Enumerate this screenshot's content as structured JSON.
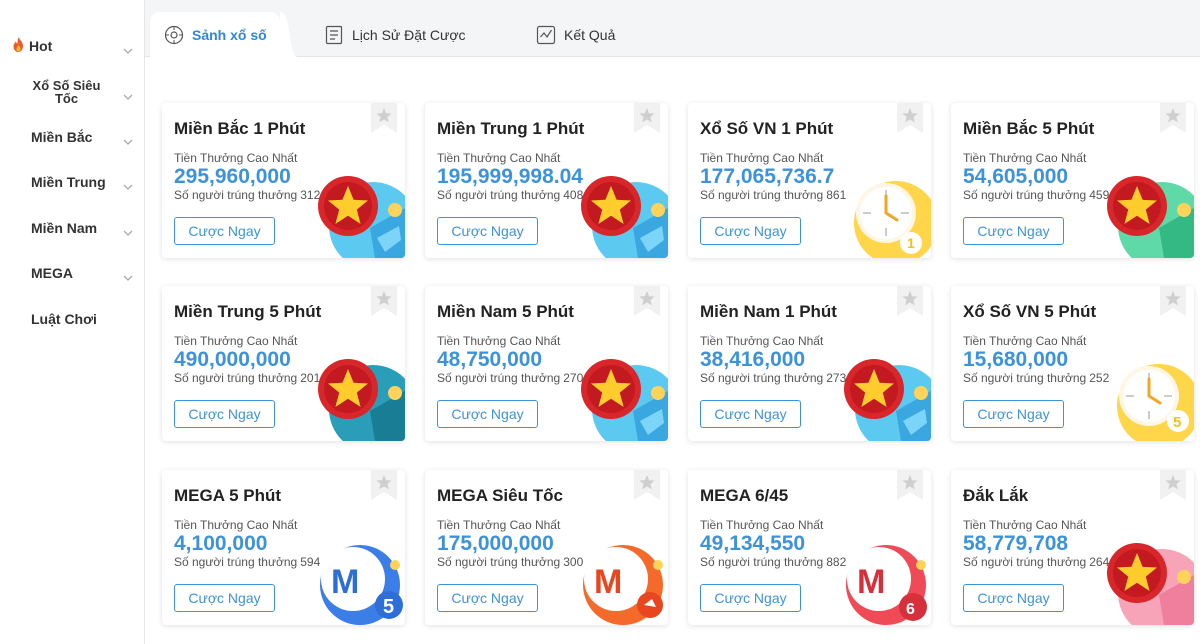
{
  "sidebar": {
    "items": [
      {
        "label": "Hot",
        "hot": true
      },
      {
        "label": "Xổ Số Siêu Tốc"
      },
      {
        "label": "Miền Bắc"
      },
      {
        "label": "Miền Trung"
      },
      {
        "label": "Miền Nam"
      },
      {
        "label": "MEGA"
      },
      {
        "label": "Luật Chơi"
      }
    ]
  },
  "tabs": [
    {
      "label": "Sảnh xổ số",
      "icon": "lottery-hall-icon",
      "active": true
    },
    {
      "label": "Lịch Sử Đặt Cược",
      "icon": "history-icon",
      "active": false
    },
    {
      "label": "Kết Quả",
      "icon": "results-icon",
      "active": false
    }
  ],
  "colors": {
    "accent": "#3d93d9",
    "active_tab": "#2f87d5"
  },
  "cards": [
    {
      "title": "Miền Bắc 1 Phút",
      "prize_label": "Tiền Thưởng Cao Nhất",
      "amount": "295,960,000",
      "winners_label": "Số người trúng thưởng",
      "winners": "312",
      "button": "Cược Ngay",
      "art": "star-blue-icon"
    },
    {
      "title": "Miền Trung 1 Phút",
      "prize_label": "Tiền Thưởng Cao Nhất",
      "amount": "195,999,998.04",
      "winners_label": "Số người trúng thưởng",
      "winners": "408",
      "button": "Cược Ngay",
      "art": "star-blue-icon"
    },
    {
      "title": "Xổ Số VN 1 Phút",
      "prize_label": "Tiền Thưởng Cao Nhất",
      "amount": "177,065,736.7",
      "winners_label": "Số người trúng thưởng",
      "winners": "861",
      "button": "Cược Ngay",
      "art": "clock-1-icon"
    },
    {
      "title": "Miền Bắc 5 Phút",
      "prize_label": "Tiền Thưởng Cao Nhất",
      "amount": "54,605,000",
      "winners_label": "Số người trúng thưởng",
      "winners": "459",
      "button": "Cược Ngay",
      "art": "star-green-icon"
    },
    {
      "title": "Miền Trung 5 Phút",
      "prize_label": "Tiền Thưởng Cao Nhất",
      "amount": "490,000,000",
      "winners_label": "Số người trúng thưởng",
      "winners": "201",
      "button": "Cược Ngay",
      "art": "star-teal-icon"
    },
    {
      "title": "Miền Nam 5 Phút",
      "prize_label": "Tiền Thưởng Cao Nhất",
      "amount": "48,750,000",
      "winners_label": "Số người trúng thưởng",
      "winners": "270",
      "button": "Cược Ngay",
      "art": "star-blue-icon"
    },
    {
      "title": "Miền Nam 1 Phút",
      "prize_label": "Tiền Thưởng Cao Nhất",
      "amount": "38,416,000",
      "winners_label": "Số người trúng thưởng",
      "winners": "273",
      "button": "Cược Ngay",
      "art": "star-blue-icon"
    },
    {
      "title": "Xổ Số VN 5 Phút",
      "prize_label": "Tiền Thưởng Cao Nhất",
      "amount": "15,680,000",
      "winners_label": "Số người trúng thưởng",
      "winners": "252",
      "button": "Cược Ngay",
      "art": "clock-5-icon"
    },
    {
      "title": "MEGA 5 Phút",
      "prize_label": "Tiền Thưởng Cao Nhất",
      "amount": "4,100,000",
      "winners_label": "Số người trúng thưởng",
      "winners": "594",
      "button": "Cược Ngay",
      "art": "mega-blue-icon"
    },
    {
      "title": "MEGA Siêu Tốc",
      "prize_label": "Tiền Thưởng Cao Nhất",
      "amount": "175,000,000",
      "winners_label": "Số người trúng thưởng",
      "winners": "300",
      "button": "Cược Ngay",
      "art": "mega-orange-icon"
    },
    {
      "title": "MEGA 6/45",
      "prize_label": "Tiền Thưởng Cao Nhất",
      "amount": "49,134,550",
      "winners_label": "Số người trúng thưởng",
      "winners": "882",
      "button": "Cược Ngay",
      "art": "mega-red-icon"
    },
    {
      "title": "Đắk Lắk",
      "prize_label": "Tiền Thưởng Cao Nhất",
      "amount": "58,779,708",
      "winners_label": "Số người trúng thưởng",
      "winners": "264",
      "button": "Cược Ngay",
      "art": "star-pink-icon"
    }
  ]
}
